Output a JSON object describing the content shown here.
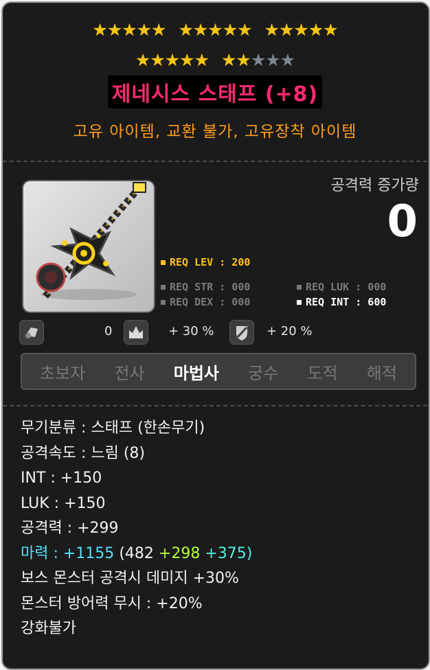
{
  "item": {
    "stars": {
      "row1": [
        5,
        5,
        5
      ],
      "row2_filled": 7,
      "row2_total": 10,
      "filled_color": "#f5c518",
      "empty_color": "#7f8790"
    },
    "name": "제네시스 스태프 (+8)",
    "name_color": "#ff2a72",
    "tags": "고유 아이템, 교환 불가, 고유장착 아이템",
    "attack_increase_label": "공격력 증가량",
    "attack_increase_value": "0",
    "requirements": {
      "lev": "REQ LEV : 200",
      "str": "REQ STR : 000",
      "luk": "REQ LUK : 000",
      "dex": "REQ DEX : 000",
      "int": "REQ INT : 600"
    },
    "icons_row": {
      "first_value": "0",
      "second_value": "+ 30 %",
      "third_value": "+ 20 %"
    },
    "jobs": [
      "초보자",
      "전사",
      "마법사",
      "궁수",
      "도적",
      "해적"
    ],
    "active_job": "마법사",
    "stats": {
      "weapon_type": "무기분류 : 스태프 (한손무기)",
      "attack_speed": "공격속도 : 느림 (8)",
      "int": "INT : +150",
      "luk": "LUK : +150",
      "attack": "공격력 : +299",
      "magic_label": "마력 : +1155",
      "magic_base": "(482",
      "magic_bonus1": "+298",
      "magic_bonus2": "+375)",
      "boss_damage": "보스 몬스터 공격시 데미지 +30%",
      "ignore_def": "몬스터 방어력 무시 : +20%",
      "no_enhance": "강화불가"
    }
  }
}
